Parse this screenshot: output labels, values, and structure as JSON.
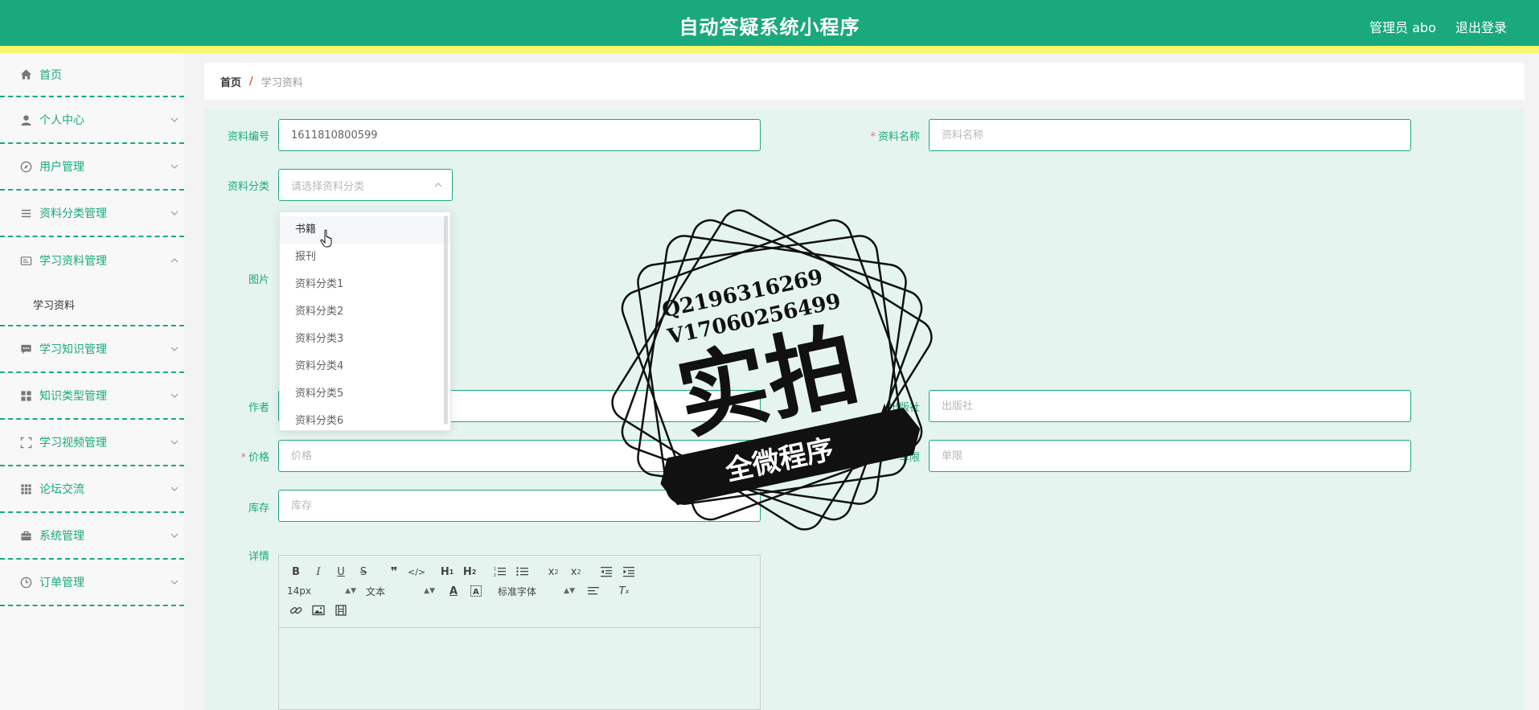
{
  "header": {
    "title": "自动答疑系统小程序",
    "admin": "管理员 abo",
    "logout": "退出登录"
  },
  "colors": {
    "primary": "#1aa97b",
    "stripe": "#f5f86a",
    "required": "#f56c6c"
  },
  "sidebar": {
    "items": [
      {
        "label": "首页",
        "icon": "home-icon"
      },
      {
        "label": "个人中心",
        "icon": "user-icon"
      },
      {
        "label": "用户管理",
        "icon": "compass-icon"
      },
      {
        "label": "资料分类管理",
        "icon": "list-icon"
      },
      {
        "label": "学习资料管理",
        "icon": "card-icon",
        "expanded": true,
        "children": [
          "学习资料"
        ]
      },
      {
        "label": "学习知识管理",
        "icon": "chat-icon"
      },
      {
        "label": "知识类型管理",
        "icon": "grid-icon"
      },
      {
        "label": "学习视频管理",
        "icon": "fullscreen-icon"
      },
      {
        "label": "论坛交流",
        "icon": "apps-icon"
      },
      {
        "label": "系统管理",
        "icon": "briefcase-icon"
      },
      {
        "label": "订单管理",
        "icon": "clock-icon"
      }
    ]
  },
  "breadcrumb": {
    "home": "首页",
    "separator": "/",
    "current": "学习资料"
  },
  "form": {
    "code_label": "资料编号",
    "code_value": "1611810800599",
    "name_label": "资料名称",
    "name_placeholder": "资料名称",
    "category_label": "资料分类",
    "category_placeholder": "请选择资料分类",
    "image_label": "图片",
    "author_label": "作者",
    "publisher_label": "出版社",
    "publisher_placeholder": "出版社",
    "price_label": "价格",
    "price_placeholder": "价格",
    "limit_label": "单限",
    "limit_placeholder": "单限",
    "stock_label": "库存",
    "stock_placeholder": "库存",
    "detail_label": "详情"
  },
  "dropdown": {
    "options": [
      "书籍",
      "报刊",
      "资料分类1",
      "资料分类2",
      "资料分类3",
      "资料分类4",
      "资料分类5",
      "资料分类6"
    ],
    "hovered": "书籍"
  },
  "editor": {
    "size_select": "14px",
    "header_select": "文本",
    "font_select": "标准字体"
  },
  "watermark": {
    "line1": "Q2196316269",
    "line2": "V17060256499",
    "big": "实拍",
    "ribbon": "全微程序"
  }
}
